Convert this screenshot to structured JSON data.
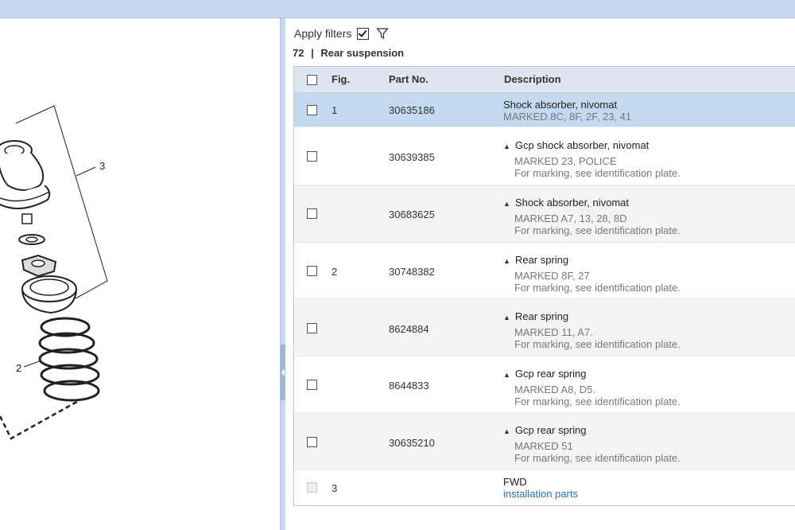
{
  "filters": {
    "apply_label": "Apply filters",
    "checked": true
  },
  "section": {
    "number": "72",
    "separator": "|",
    "title": "Rear suspension"
  },
  "table": {
    "headers": {
      "fig": "Fig.",
      "part_no": "Part No.",
      "description": "Description"
    },
    "rows": [
      {
        "fig": "1",
        "part_no": "30635186",
        "line1": "Shock absorber, nivomat",
        "line2": "MARKED 8C, 8F, 2F, 23, 41",
        "line3": "",
        "expanded": false,
        "selected": true
      },
      {
        "fig": "",
        "part_no": "30639385",
        "line1": "Gcp shock absorber, nivomat",
        "line2": "MARKED 23, POLICE",
        "line3": "For marking, see identification plate.",
        "expanded": true
      },
      {
        "fig": "",
        "part_no": "30683625",
        "line1": "Shock absorber, nivomat",
        "line2": "MARKED A7, 13, 28, 8D",
        "line3": "For marking, see identification plate.",
        "expanded": true
      },
      {
        "fig": "2",
        "part_no": "30748382",
        "line1": "Rear spring",
        "line2": "MARKED 8F, 27",
        "line3": "For marking, see identification plate.",
        "expanded": true
      },
      {
        "fig": "",
        "part_no": "8624884",
        "line1": "Rear spring",
        "line2": "MARKED 11, A7.",
        "line3": "For marking, see identification plate.",
        "expanded": true
      },
      {
        "fig": "",
        "part_no": "8644833",
        "line1": "Gcp rear spring",
        "line2": "MARKED A8, D5.",
        "line3": "For marking, see identification plate.",
        "expanded": true
      },
      {
        "fig": "",
        "part_no": "30635210",
        "line1": "Gcp rear spring",
        "line2": "MARKED 51",
        "line3": "For marking, see identification plate.",
        "expanded": true
      },
      {
        "fig": "3",
        "part_no": "",
        "line1": "FWD",
        "line2": "installation parts",
        "line3": "",
        "expanded": false,
        "disabled": true
      }
    ]
  },
  "diagram": {
    "callouts": [
      "3",
      "2"
    ]
  },
  "colors": {
    "topbar": "#c6d9ee",
    "selected_row": "#c2d9f0",
    "header": "#dde6f0",
    "link": "#2b6cb0"
  }
}
